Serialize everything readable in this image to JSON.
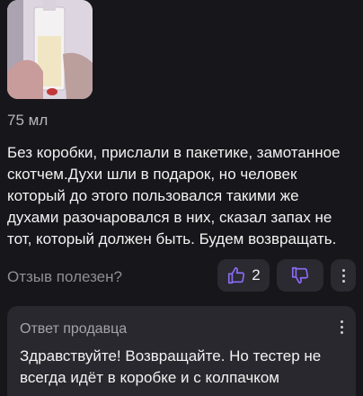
{
  "review": {
    "photo_alt": "perfume-photo",
    "variant": "75 мл",
    "text": "Без коробки, прислали в пакетике, замотанное скотчем.Духи шли в подарок, но человек который до этого пользовался такими же духами разочаровался в них, сказал запах не тот, который должен быть. Будем возвращать."
  },
  "helpful": {
    "label": "Отзыв полезен?",
    "like_count": "2",
    "accent_color": "#8b6cf6"
  },
  "seller_reply": {
    "title": "Ответ продавца",
    "text": "Здравствуйте! Возвращайте. Но тестер не всегда идёт в коробке и с колпачком"
  }
}
